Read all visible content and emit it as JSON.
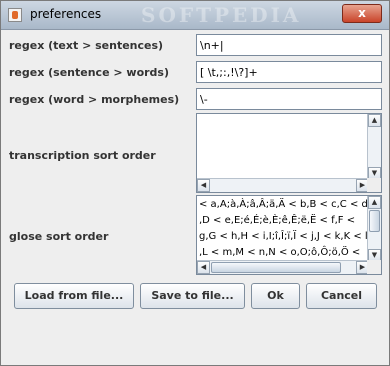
{
  "window": {
    "title": "preferences",
    "watermark": "SOFTPEDIA",
    "close_label": "x"
  },
  "fields": {
    "sentences": {
      "label": "regex (text > sentences)",
      "value": "\\n+|"
    },
    "words": {
      "label": "regex (sentence > words)",
      "value": "[ \\t,;:,!\\?]+"
    },
    "morphemes": {
      "label": "regex (word > morphemes)",
      "value": "\\-"
    },
    "transcription": {
      "label": "transcription sort order",
      "value": ""
    },
    "glose": {
      "label": "glose sort order",
      "lines": [
        "< a,A;à,À;â,Â;ä,Ä < b,B < c,C < d",
        ",D < e,E;é,É;è,È;ê,Ê;ë,Ë < f,F <",
        "g,G < h,H < i,I;î,Î;ï,Ï < j,J < k,K < l",
        ",L < m,M < n,N < o,O;ô,Ô;ö,Ö <"
      ]
    }
  },
  "buttons": {
    "load": "Load from file...",
    "save": "Save to file...",
    "ok": "Ok",
    "cancel": "Cancel"
  },
  "icons": {
    "scroll_left": "◀",
    "scroll_right": "▶",
    "scroll_up": "▲",
    "scroll_down": "▼"
  }
}
